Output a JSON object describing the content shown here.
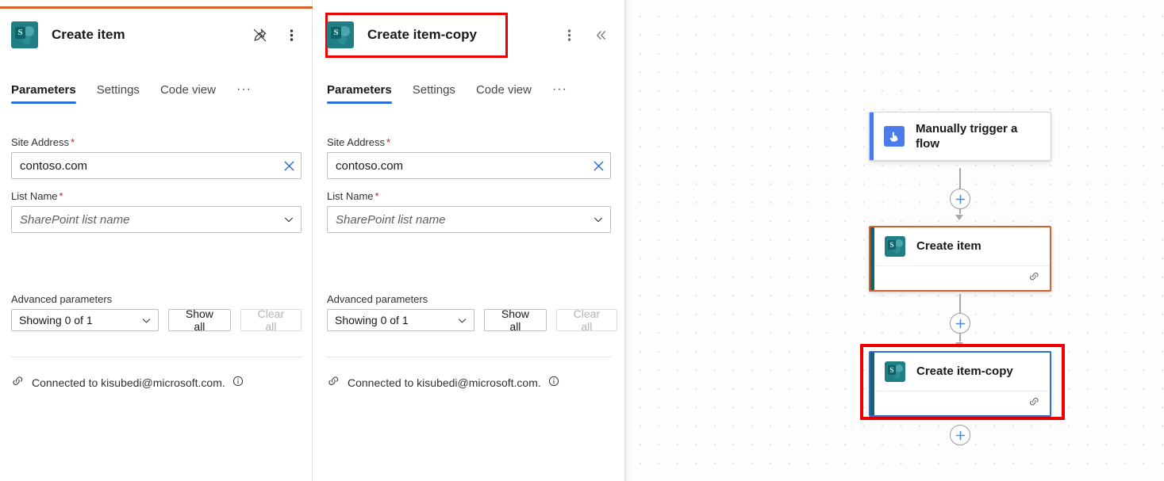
{
  "panels": [
    {
      "icon": "sharepoint-icon",
      "title": "Create item",
      "accent_color": "#d9622b",
      "highlighted": false,
      "actions": [
        "unpin-icon",
        "more-vertical-icon"
      ],
      "tabs": [
        {
          "label": "Parameters",
          "active": true
        },
        {
          "label": "Settings",
          "active": false
        },
        {
          "label": "Code view",
          "active": false
        }
      ],
      "tabs_overflow": "···",
      "fields": [
        {
          "label": "Site Address",
          "required": true,
          "value": "contoso.com",
          "placeholder": "",
          "trailing_icon": "clear-x-icon"
        },
        {
          "label": "List Name",
          "required": true,
          "value": "",
          "placeholder": "SharePoint list name",
          "trailing_icon": "chevron-down-icon"
        }
      ],
      "advanced": {
        "label": "Advanced parameters",
        "select_value": "Showing 0 of 1",
        "show_all_label": "Show all",
        "clear_all_label": "Clear all",
        "clear_all_disabled": true
      },
      "connection": {
        "icon": "link-icon",
        "text": "Connected to kisubedi@microsoft.com.",
        "info_icon": "info-icon"
      }
    },
    {
      "icon": "sharepoint-icon",
      "title": "Create item-copy",
      "accent_color": "#d9622b",
      "highlighted": true,
      "actions": [
        "more-vertical-icon",
        "collapse-left-icon"
      ],
      "tabs": [
        {
          "label": "Parameters",
          "active": true
        },
        {
          "label": "Settings",
          "active": false
        },
        {
          "label": "Code view",
          "active": false
        }
      ],
      "tabs_overflow": "···",
      "fields": [
        {
          "label": "Site Address",
          "required": true,
          "value": "contoso.com",
          "placeholder": "",
          "trailing_icon": "clear-x-icon"
        },
        {
          "label": "List Name",
          "required": true,
          "value": "",
          "placeholder": "SharePoint list name",
          "trailing_icon": "chevron-down-icon"
        }
      ],
      "advanced": {
        "label": "Advanced parameters",
        "select_value": "Showing 0 of 1",
        "show_all_label": "Show all",
        "clear_all_label": "Clear all",
        "clear_all_disabled": true
      },
      "connection": {
        "icon": "link-icon",
        "text": "Connected to kisubedi@microsoft.com.",
        "info_icon": "info-icon"
      }
    }
  ],
  "canvas": {
    "nodes": [
      {
        "label": "Manually trigger a flow",
        "icon": "manual-trigger-icon",
        "accent_color": "#4a7aeb",
        "selection": "none",
        "highlighted": false,
        "has_footer": false
      },
      {
        "label": "Create item",
        "icon": "sharepoint-icon",
        "accent_color": "#13656b",
        "selection": "orange",
        "highlighted": false,
        "has_footer": true,
        "footer_icon": "link-icon"
      },
      {
        "label": "Create item-copy",
        "icon": "sharepoint-icon",
        "accent_color": "#13656b",
        "selection": "blue",
        "highlighted": true,
        "has_footer": true,
        "footer_icon": "link-icon"
      }
    ],
    "add_buttons": [
      "add-step-1",
      "add-step-2",
      "add-step-3"
    ],
    "sharepoint_letter": "S"
  }
}
